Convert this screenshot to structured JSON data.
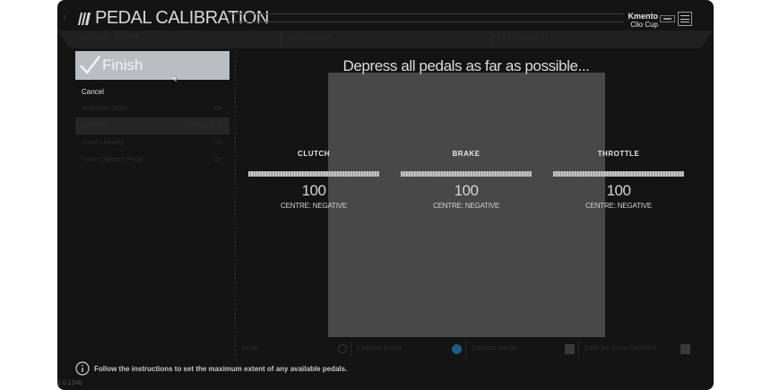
{
  "header": {
    "title": "PEDAL CALIBRATION",
    "profile_name": "Kmento",
    "profile_car": "Clio Cup"
  },
  "tabs": [
    {
      "label": "CONTROL SCHEME"
    },
    {
      "label": "CONTROLLER"
    },
    {
      "label": "KEY ASSIGNMENT"
    }
  ],
  "sidebar": {
    "finish_label": "Finish",
    "cancel_label": "Cancel",
    "items": [
      {
        "label": "Automatic Scale",
        "value": "On"
      },
      {
        "label": "Linearity",
        "value": "Default (0.5)"
      },
      {
        "label": "Invert Linearity",
        "value": "On"
      },
      {
        "label": "Invert Clamped Pedal",
        "value": "On"
      }
    ]
  },
  "main": {
    "instruction": "Depress all pedals as far as possible...",
    "pedals": [
      {
        "name": "CLUTCH",
        "value": "100",
        "centre": "CENTRE: NEGATIVE",
        "fill": 1.0
      },
      {
        "name": "BRAKE",
        "value": "100",
        "centre": "CENTRE: NEGATIVE",
        "fill": 1.0
      },
      {
        "name": "THROTTLE",
        "value": "100",
        "centre": "CENTRE: NEGATIVE",
        "fill": 1.0
      }
    ]
  },
  "controls": [
    {
      "label": "Reset"
    },
    {
      "label": "Calibrate Arrival"
    },
    {
      "label": "Calibrate Range"
    },
    {
      "label": "Calibrate Force Feedback"
    }
  ],
  "footer": {
    "hint": "Follow the instructions to set the maximum extent of any available pedals.",
    "version": "1.0.1246"
  },
  "colors": {
    "background": "#141414",
    "finish_bg": "#b8bec2",
    "instruction_box": "#484848",
    "accent_dot": "#1d5d84"
  }
}
